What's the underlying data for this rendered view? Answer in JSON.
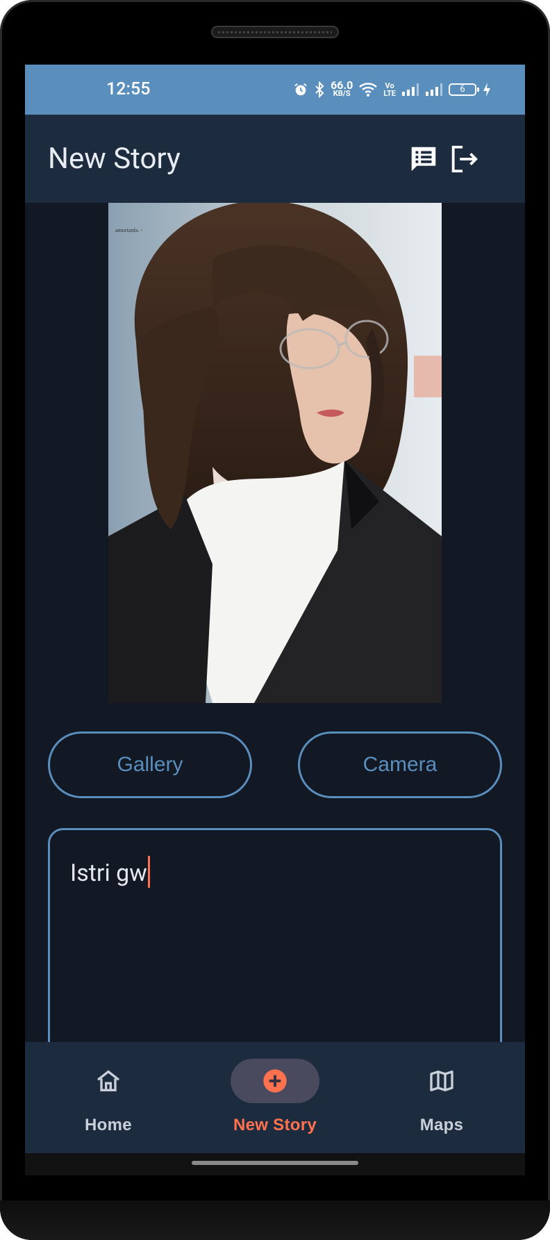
{
  "status_bar": {
    "time": "12:55",
    "net_speed": "66.0",
    "net_speed_unit": "KB/S",
    "volte": "VoLTE",
    "battery": "6"
  },
  "app_bar": {
    "title": "New Story",
    "actions": [
      "story-list-icon",
      "logout-icon"
    ]
  },
  "buttons": {
    "gallery": "Gallery",
    "camera": "Camera"
  },
  "description": {
    "value": "Istri gw"
  },
  "bottom_nav": {
    "items": [
      {
        "label": "Home",
        "icon": "home-icon",
        "active": false
      },
      {
        "label": "New Story",
        "icon": "add-circle-icon",
        "active": true
      },
      {
        "label": "Maps",
        "icon": "map-icon",
        "active": false
      }
    ]
  },
  "colors": {
    "primary": "#5a8ebd",
    "accent": "#ff7250",
    "surface": "#1d2b3f",
    "background": "#121924"
  }
}
